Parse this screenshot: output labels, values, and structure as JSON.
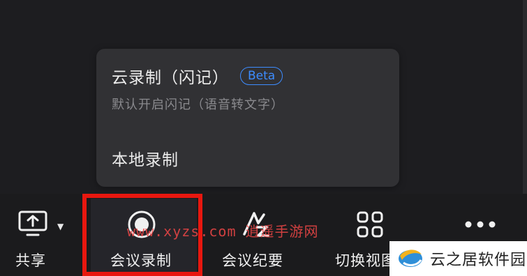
{
  "recording_menu": {
    "cloud_title": "云录制（闪记）",
    "cloud_badge": "Beta",
    "cloud_subtitle": "默认开启闪记（语音转文字）",
    "local_label": "本地录制"
  },
  "toolbar": {
    "share_label": "共享",
    "record_label": "会议录制",
    "summary_label": "会议纪要",
    "switch_label": "切换视图"
  },
  "watermarks": {
    "site_text": "www.xyzs.com 逍遥手游网",
    "brand_name": "云之居软件园"
  },
  "colors": {
    "highlight_border": "#e8170f",
    "badge": "#3d8cff",
    "background": "#1d1d20"
  }
}
